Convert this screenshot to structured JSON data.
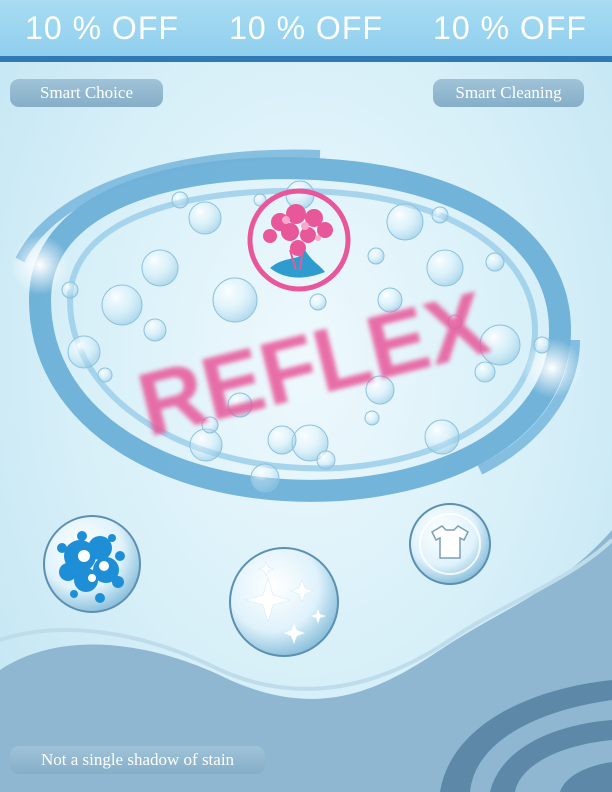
{
  "banner": {
    "offers": [
      "10 % OFF",
      "10 % OFF",
      "10 % OFF"
    ]
  },
  "tags": {
    "left": "Smart Choice",
    "right": "Smart Cleaning",
    "bottom": "Not a single shadow of stain"
  },
  "brand": {
    "name": "REFLEX",
    "color": "#e8579a"
  },
  "icons": {
    "logo": "flower-emblem-icon",
    "badge_1": "bubbles-icon",
    "badge_2": "sparkle-icon",
    "badge_3": "tshirt-icon"
  },
  "colors": {
    "banner": "#8fcfee",
    "banner_line": "#2f79b5",
    "swoosh": "#5fa8d3",
    "wave": "#8fb7d2",
    "wave_dark": "#5e88a8"
  }
}
